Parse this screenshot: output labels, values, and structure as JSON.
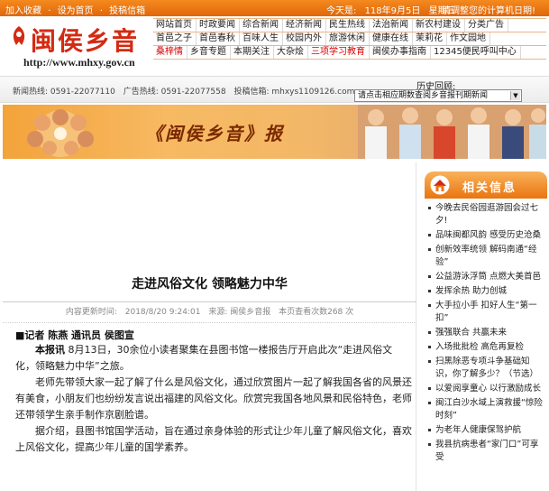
{
  "topbar": {
    "links": [
      "加入收藏",
      "设为首页",
      "投稿信箱"
    ],
    "separator": "·",
    "date_label": "今天是:",
    "date": "118年9月5日",
    "weekday": "星期三",
    "notice": "请调整您的计算机日期!"
  },
  "logo": {
    "title": "闽侯乡音",
    "url": "http://www.mhxy.gov.cn"
  },
  "nav": {
    "rows": [
      [
        "网站首页",
        "时政要闻",
        "综合新闻",
        "经济新闻",
        "民生热线",
        "法治新闻",
        "新农村建设",
        "分类广告"
      ],
      [
        "首邑之子",
        "首邑春秋",
        "百味人生",
        "校园内外",
        "旅游休闲",
        "健康在线",
        "茉莉花",
        "作文园地"
      ],
      [
        "桑梓情",
        "乡音专题",
        "本期关注",
        "大杂烩",
        "三项学习教育",
        "闽侯办事指南",
        "12345便民呼叫中心"
      ]
    ],
    "highlight_red": [
      "桑梓情",
      "三项学习教育"
    ]
  },
  "hotline": {
    "news": "新闻热线: 0591-22077110",
    "ad": "广告热线: 0591-22077558",
    "email": "投稿信箱: mhxys1109126.com",
    "history_label": "历史回顾:",
    "history_select": "请点击相应期数查阅乡音报刊期新闻"
  },
  "banner": {
    "title": "《闽侯乡音》报"
  },
  "article": {
    "title": "走进风俗文化 领略魅力中华",
    "meta_update": "内容更新时间:",
    "meta_time": "2018/8/20 9:24:01",
    "meta_source": "来源: 闽侯乡音报",
    "meta_reads": "本页查看次数268 次",
    "byline": "■记者 陈燕 通讯员 侯图宣",
    "body_lead": "本报讯",
    "paragraphs": [
      " 8月13日，30余位小读者聚集在县图书馆一楼报告厅开启此次“走进风俗文化，领略魅力中华”之旅。",
      "老师先带领大家一起了解了什么是风俗文化，通过欣赏图片一起了解我国各省的风景还有美食，小朋友们也纷纷发言说出福建的风俗文化。欣赏完我国各地风景和民俗特色，老师还带领学生亲手制作京剧脸谱。",
      "据介绍，县图书馆国学活动，旨在通过亲身体验的形式让少年儿童了解风俗文化，喜欢上风俗文化，提高少年儿童的国学素养。"
    ]
  },
  "sidebar": {
    "title": "相关信息",
    "items": [
      "今晚去民俗园逛游园会过七夕!",
      "品味闽都风韵 感受历史沧桑",
      "创新效率统领 解码南通“经验”",
      "公益游泳浮筒 点燃大美首邑",
      "发挥余热 助力创城",
      "大手拉小手 扣好人生“第一扣”",
      "强强联合 共赢未来",
      "入场批批检 高危再复检",
      "扫黑除恶专项斗争基础知识，你了解多少？（节选）",
      "以爱阅享童心 以行激励成长",
      "闽江白沙水域上演救援“惊险时刻”",
      "为老年人健康保驾护航",
      "我县抗病患者“家门口”可享受"
    ]
  },
  "colors": {
    "topbar": "#e8761a",
    "logo_red": "#d42a12",
    "nav_red": "#d60000",
    "banner_orange": "#f3a33a",
    "sidebar_header": "#e97510"
  }
}
